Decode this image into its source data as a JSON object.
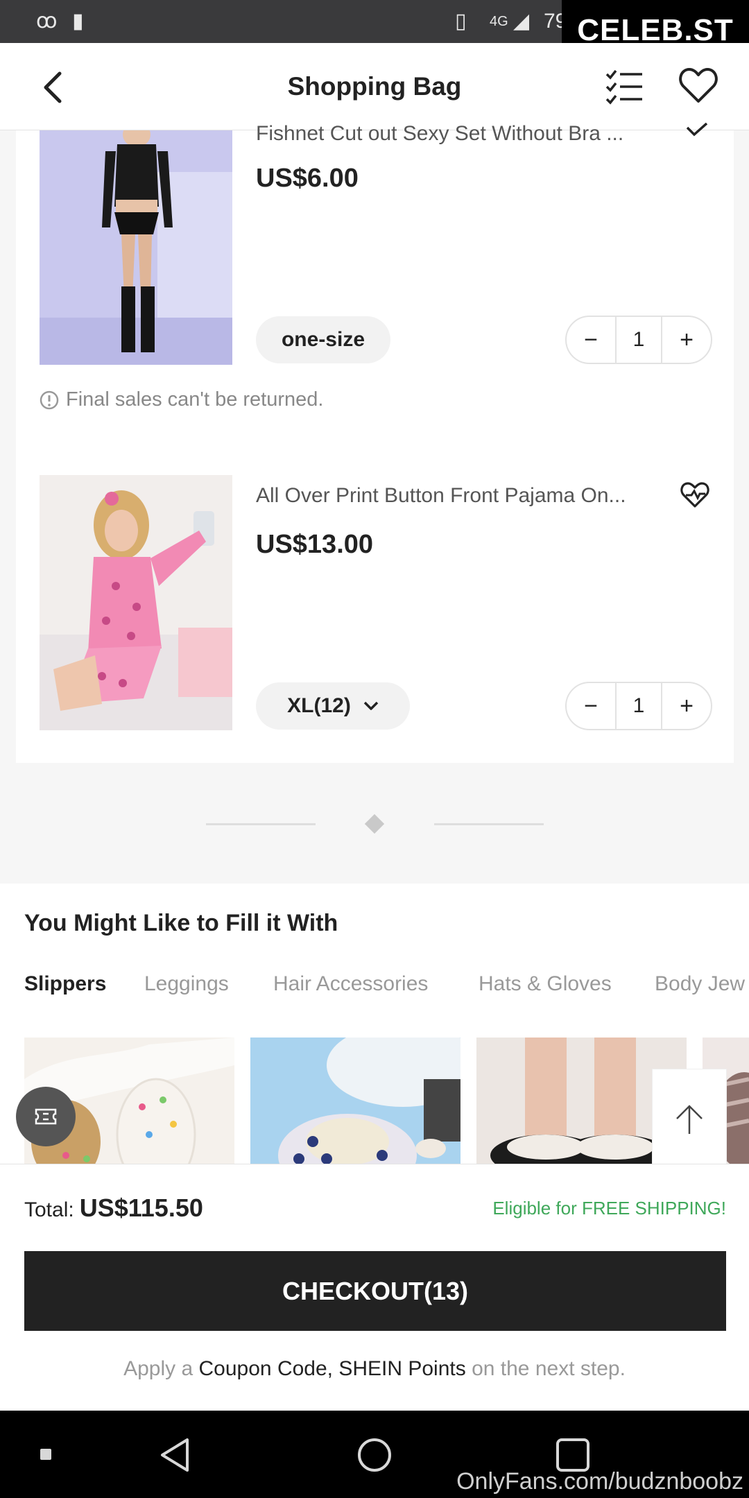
{
  "status_bar": {
    "battery_text": "79"
  },
  "watermark": {
    "top": "CELEB.ST",
    "bottom": "OnlyFans.com/budznboobz"
  },
  "header": {
    "title": "Shopping Bag"
  },
  "cart": {
    "items": [
      {
        "name": "Fishnet Cut out Sexy Set Without Bra ...",
        "price": "US$6.00",
        "size": "one-size",
        "quantity": "1",
        "notice": "Final sales can't be returned."
      },
      {
        "name": "All Over Print Button Front Pajama On...",
        "price": "US$13.00",
        "size": "XL(12)",
        "quantity": "1"
      }
    ]
  },
  "recommendations": {
    "title": "You Might Like to Fill it With",
    "tabs": [
      "Slippers",
      "Leggings",
      "Hair Accessories",
      "Hats & Gloves",
      "Body Jew"
    ]
  },
  "footer": {
    "total_label": "Total:",
    "total_value": "US$115.50",
    "shipping_note": "Eligible for FREE SHIPPING!",
    "checkout_label": "CHECKOUT(13)",
    "apply_prefix": "Apply a",
    "apply_links": "Coupon Code, SHEIN Points",
    "apply_suffix": "on the next step."
  },
  "colors": {
    "accent_green": "#3fa85a",
    "checkout_bg": "#222222"
  },
  "icons": [
    "back-icon",
    "checklist-icon",
    "wishlist-heart-icon",
    "heart-add-icon",
    "minus-icon",
    "plus-icon",
    "chevron-down-icon",
    "info-icon",
    "coupon-icon",
    "arrow-up-icon",
    "nav-back-icon",
    "nav-home-icon",
    "nav-recents-icon"
  ]
}
